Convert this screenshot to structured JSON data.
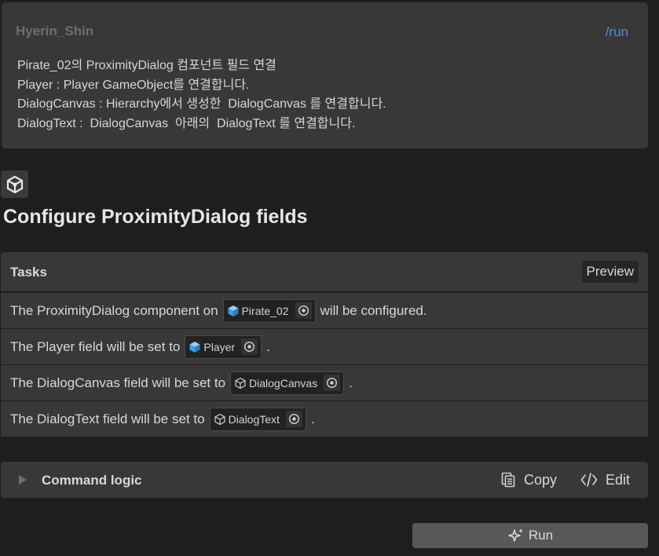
{
  "message": {
    "user": "Hyerin_Shin",
    "command": "/run",
    "lines": [
      "Pirate_02의 ProximityDialog 컴포넌트 필드 연결",
      "Player : Player GameObject를 연결합니다.",
      "DialogCanvas : Hierarchy에서 생성한  DialogCanvas 를 연결합니다.",
      "DialogText :  DialogCanvas  아래의  DialogText 를 연결합니다."
    ]
  },
  "assistant": {
    "icon": "unity-cube-icon",
    "title": "Configure ProximityDialog fields"
  },
  "tasks": {
    "header": "Tasks",
    "preview_label": "Preview",
    "rows": [
      {
        "pre": "The ProximityDialog component on",
        "ref": "Pirate_02",
        "ref_icon": "prefab-cube-icon",
        "post": "will be configured."
      },
      {
        "pre": "The Player field will be set to",
        "ref": "Player",
        "ref_icon": "prefab-cube-icon",
        "post": "."
      },
      {
        "pre": "The DialogCanvas field will be set to",
        "ref": "DialogCanvas",
        "ref_icon": "gameobject-cube-icon",
        "post": "."
      },
      {
        "pre": "The DialogText field will be set to",
        "ref": "DialogText",
        "ref_icon": "gameobject-cube-icon",
        "post": "."
      }
    ]
  },
  "command_logic": {
    "label": "Command logic",
    "copy_label": "Copy",
    "edit_label": "Edit"
  },
  "run_label": "Run",
  "colors": {
    "background": "#1e1e1e",
    "card": "#383838",
    "link": "#4c8fdc",
    "prefab_icon": "#4fb3ef",
    "run_button": "#585858"
  }
}
